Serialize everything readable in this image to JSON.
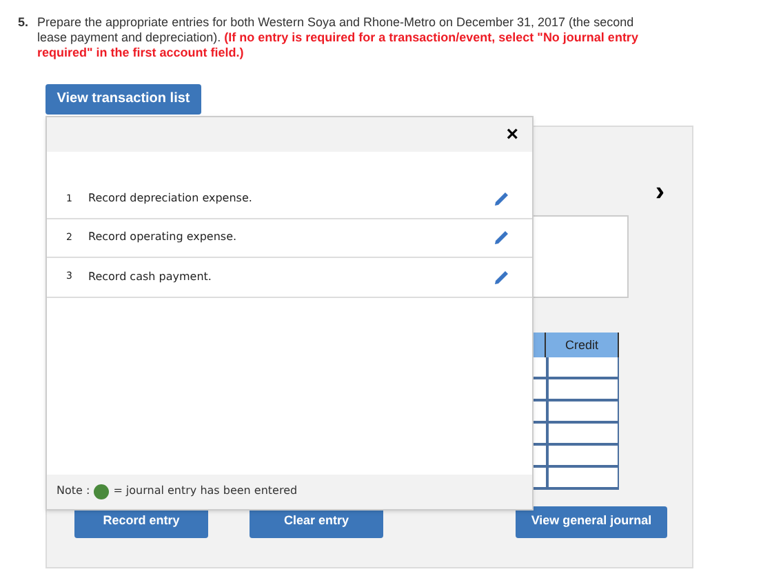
{
  "question": {
    "number": "5.",
    "text": "Prepare the appropriate entries for both Western Soya and Rhone-Metro on December 31, 2017 (the second lease payment and depreciation).",
    "warning": "(If no entry is required for a transaction/event, select \"No journal entry required\" in the first account field.)"
  },
  "view_list_button": "View transaction list",
  "popup": {
    "close": "×",
    "transactions": [
      {
        "number": "1",
        "label": "Record depreciation expense.",
        "edit": true
      },
      {
        "number": "2",
        "label": "Record operating expense.",
        "edit": true
      },
      {
        "number": "3",
        "label": "Record cash payment.",
        "edit": true
      }
    ],
    "note": {
      "label": "Note :",
      "text": "= journal entry has been entered"
    }
  },
  "next": "›",
  "journal_table": {
    "columns": [
      "Credit"
    ]
  },
  "buttons": [
    "Record entry",
    "Clear entry",
    "View general journal"
  ]
}
